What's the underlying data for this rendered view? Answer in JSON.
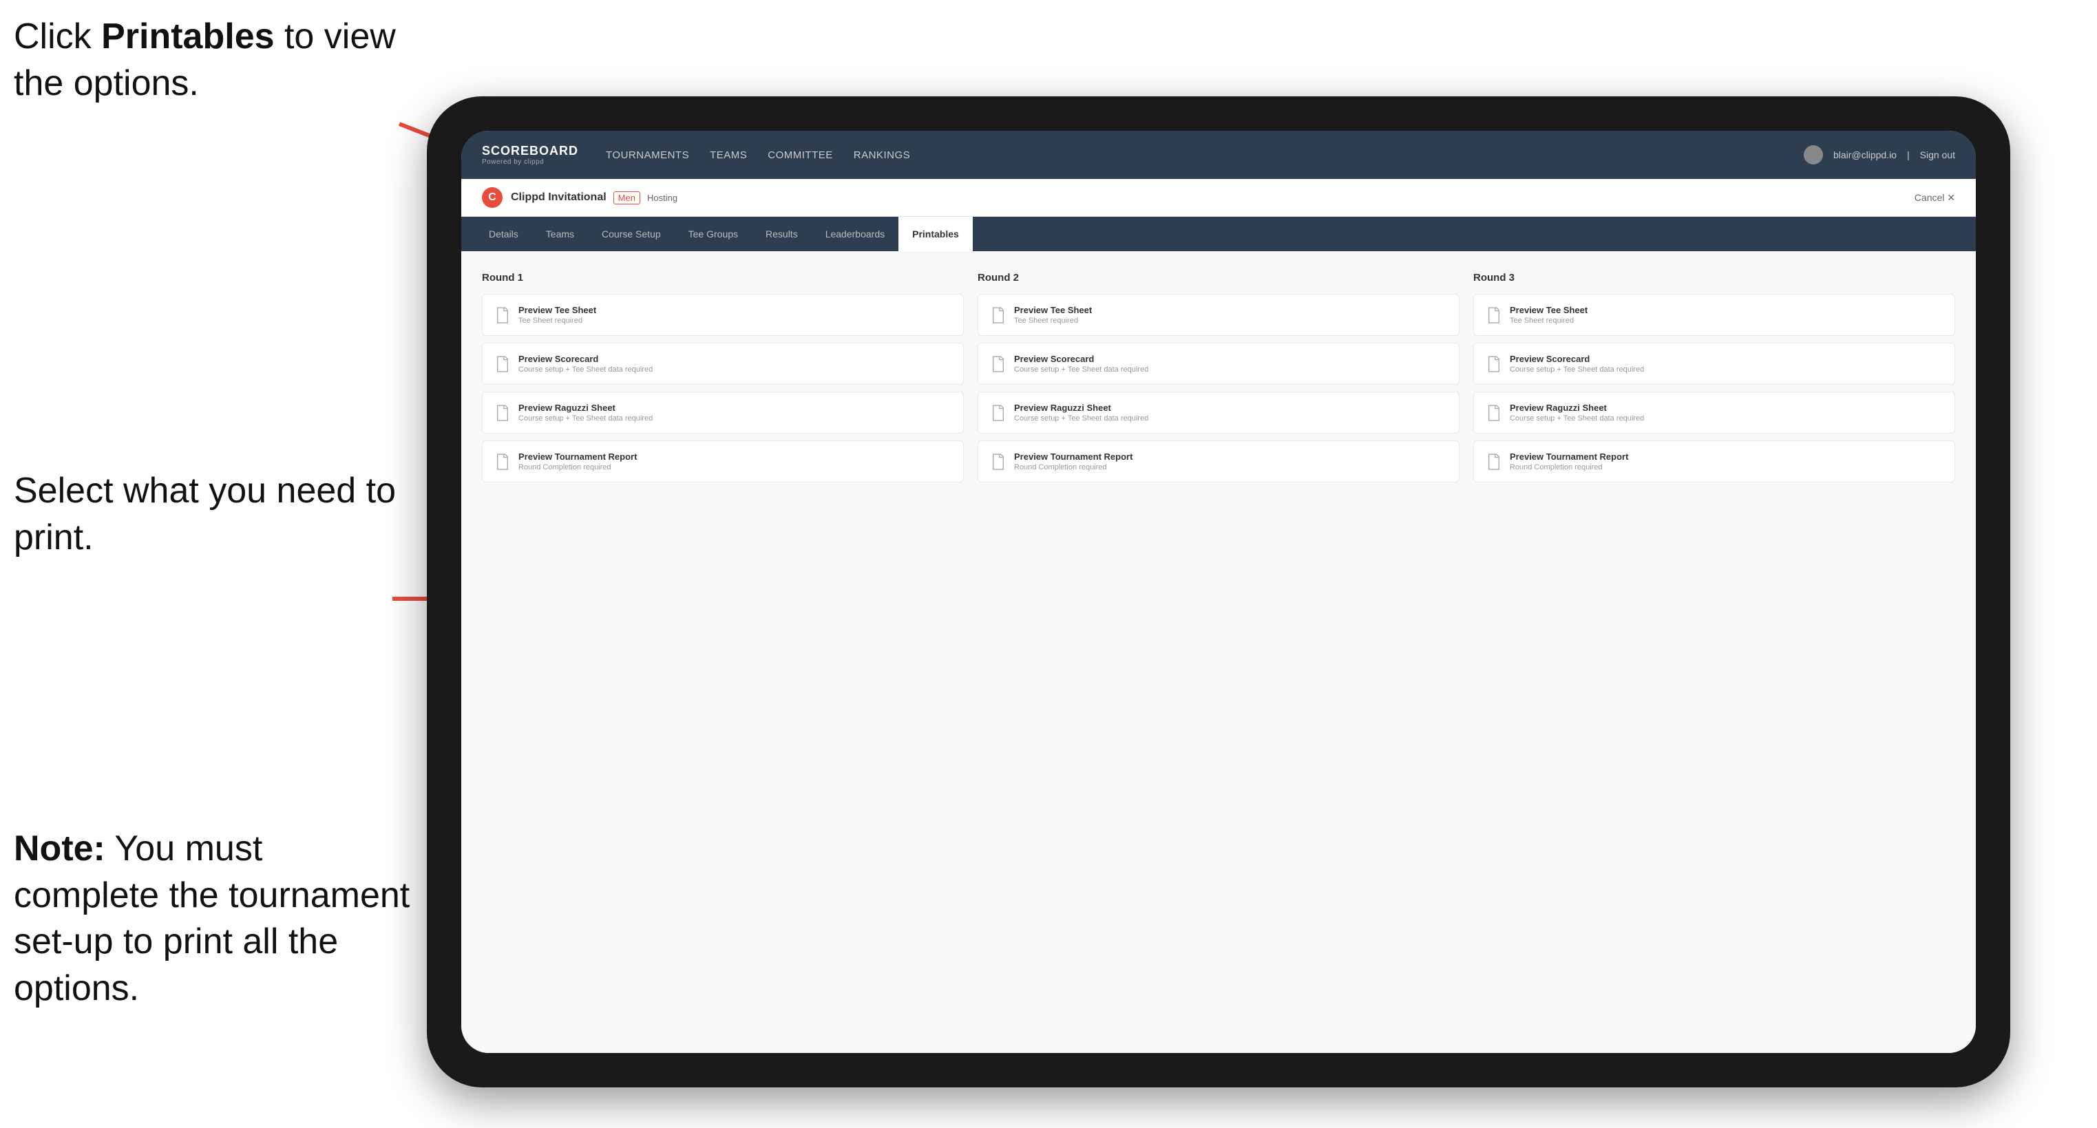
{
  "annotations": {
    "top": {
      "part1": "Click ",
      "bold": "Printables",
      "part2": " to view the options."
    },
    "middle": {
      "text": "Select what you need to print."
    },
    "bottom": {
      "bold": "Note:",
      "text": " You must complete the tournament set-up to print all the options."
    }
  },
  "nav": {
    "logo_title": "SCOREBOARD",
    "logo_sub": "Powered by clippd",
    "links": [
      {
        "label": "TOURNAMENTS",
        "active": false
      },
      {
        "label": "TEAMS",
        "active": false
      },
      {
        "label": "COMMITTEE",
        "active": false
      },
      {
        "label": "RANKINGS",
        "active": false
      }
    ],
    "user_email": "blair@clippd.io",
    "sign_out": "Sign out"
  },
  "sub_header": {
    "logo_letter": "C",
    "tournament_name": "Clippd Invitational",
    "tag": "Men",
    "hosting": "Hosting",
    "cancel": "Cancel ✕"
  },
  "tabs": [
    {
      "label": "Details",
      "active": false
    },
    {
      "label": "Teams",
      "active": false
    },
    {
      "label": "Course Setup",
      "active": false
    },
    {
      "label": "Tee Groups",
      "active": false
    },
    {
      "label": "Results",
      "active": false
    },
    {
      "label": "Leaderboards",
      "active": false
    },
    {
      "label": "Printables",
      "active": true
    }
  ],
  "rounds": [
    {
      "title": "Round 1",
      "items": [
        {
          "title": "Preview Tee Sheet",
          "subtitle": "Tee Sheet required"
        },
        {
          "title": "Preview Scorecard",
          "subtitle": "Course setup + Tee Sheet data required"
        },
        {
          "title": "Preview Raguzzi Sheet",
          "subtitle": "Course setup + Tee Sheet data required"
        },
        {
          "title": "Preview Tournament Report",
          "subtitle": "Round Completion required"
        }
      ]
    },
    {
      "title": "Round 2",
      "items": [
        {
          "title": "Preview Tee Sheet",
          "subtitle": "Tee Sheet required"
        },
        {
          "title": "Preview Scorecard",
          "subtitle": "Course setup + Tee Sheet data required"
        },
        {
          "title": "Preview Raguzzi Sheet",
          "subtitle": "Course setup + Tee Sheet data required"
        },
        {
          "title": "Preview Tournament Report",
          "subtitle": "Round Completion required"
        }
      ]
    },
    {
      "title": "Round 3",
      "items": [
        {
          "title": "Preview Tee Sheet",
          "subtitle": "Tee Sheet required"
        },
        {
          "title": "Preview Scorecard",
          "subtitle": "Course setup + Tee Sheet data required"
        },
        {
          "title": "Preview Raguzzi Sheet",
          "subtitle": "Course setup + Tee Sheet data required"
        },
        {
          "title": "Preview Tournament Report",
          "subtitle": "Round Completion required"
        }
      ]
    }
  ]
}
